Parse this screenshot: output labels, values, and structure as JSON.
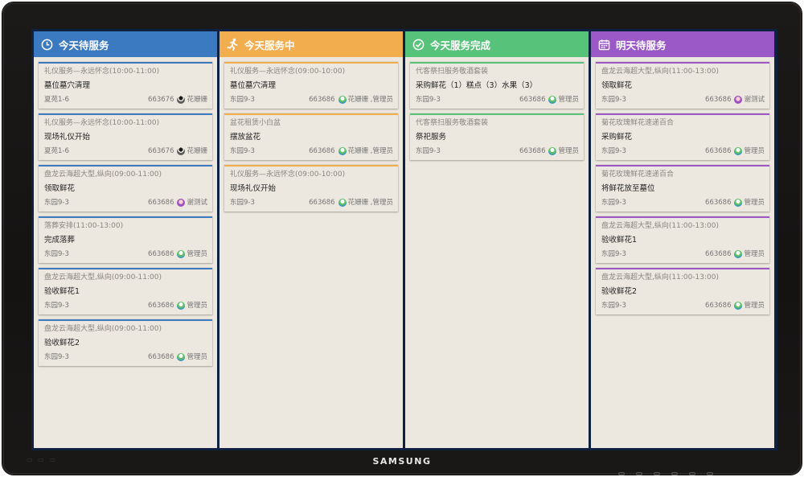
{
  "device": {
    "brand": "SAMSUNG"
  },
  "colors": {
    "pending_today": "#3b7ac0",
    "in_progress": "#f2ad4f",
    "done": "#57c27a",
    "tomorrow": "#9b59c7"
  },
  "columns": [
    {
      "title": "今天待服务",
      "icon": "clock-icon",
      "cards": [
        {
          "title": "礼仪服务—永远怀念(10:00-11:00)",
          "task": "墓位墓穴清理",
          "location": "夏苑1-6",
          "code": "663676",
          "avatar": "person-avatar",
          "user": "花姗姗"
        },
        {
          "title": "礼仪服务—永远怀念(10:00-11:00)",
          "task": "现场礼仪开始",
          "location": "夏苑1-6",
          "code": "663676",
          "avatar": "person-avatar",
          "user": "花姗姗"
        },
        {
          "title": "盘龙云海超大型,纵向(09:00-11:00)",
          "task": "领取鲜花",
          "location": "东园9-3",
          "code": "663686",
          "avatar": "purple-avatar",
          "user": "谢测试"
        },
        {
          "title": "落葬安排(11:00-13:00)",
          "task": "完成落葬",
          "location": "东园9-3",
          "code": "663686",
          "avatar": "green-avatar",
          "user": "管理员"
        },
        {
          "title": "盘龙云海超大型,纵向(09:00-11:00)",
          "task": "验收鲜花1",
          "location": "东园9-3",
          "code": "663686",
          "avatar": "green-avatar",
          "user": "管理员"
        },
        {
          "title": "盘龙云海超大型,纵向(09:00-11:00)",
          "task": "验收鲜花2",
          "location": "东园9-3",
          "code": "663686",
          "avatar": "green-avatar",
          "user": "管理员"
        }
      ]
    },
    {
      "title": "今天服务中",
      "icon": "running-person-icon",
      "cards": [
        {
          "title": "礼仪服务—永远怀念(09:00-10:00)",
          "task": "墓位墓穴清理",
          "location": "东园9-3",
          "code": "663686",
          "avatar": "green-avatar",
          "user": "花姗姗 ,管理员"
        },
        {
          "title": "盆花租赁小白盆",
          "task": "摆放盆花",
          "location": "东园9-3",
          "code": "663686",
          "avatar": "green-avatar",
          "user": "花姗姗 ,管理员"
        },
        {
          "title": "礼仪服务—永远怀念(09:00-10:00)",
          "task": "现场礼仪开始",
          "location": "东园9-3",
          "code": "663686",
          "avatar": "green-avatar",
          "user": "花姗姗 ,管理员"
        }
      ]
    },
    {
      "title": "今天服务完成",
      "icon": "check-circle-icon",
      "cards": [
        {
          "title": "代客祭扫服务敬酒套装",
          "task": "采购鲜花（1）糕点（3）水果（3）",
          "location": "东园9-3",
          "code": "663686",
          "avatar": "green-avatar",
          "user": "管理员"
        },
        {
          "title": "代客祭扫服务敬酒套装",
          "task": "祭祀服务",
          "location": "东园9-3",
          "code": "663686",
          "avatar": "green-avatar",
          "user": "管理员"
        }
      ]
    },
    {
      "title": "明天待服务",
      "icon": "calendar-icon",
      "cards": [
        {
          "title": "盘龙云海超大型,纵向(11:00-13:00)",
          "task": "领取鲜花",
          "location": "东园9-3",
          "code": "663686",
          "avatar": "purple-avatar",
          "user": "谢测试"
        },
        {
          "title": "菊花玫瑰鲜花速递百合",
          "task": "采购鲜花",
          "location": "东园9-3",
          "code": "663686",
          "avatar": "green-avatar",
          "user": "管理员"
        },
        {
          "title": "菊花玫瑰鲜花速递百合",
          "task": "将鲜花放至墓位",
          "location": "东园9-3",
          "code": "663686",
          "avatar": "green-avatar",
          "user": "管理员"
        },
        {
          "title": "盘龙云海超大型,纵向(11:00-13:00)",
          "task": "验收鲜花1",
          "location": "东园9-3",
          "code": "663686",
          "avatar": "green-avatar",
          "user": "管理员"
        },
        {
          "title": "盘龙云海超大型,纵向(11:00-13:00)",
          "task": "验收鲜花2",
          "location": "东园9-3",
          "code": "663686",
          "avatar": "green-avatar",
          "user": "管理员"
        }
      ]
    }
  ]
}
